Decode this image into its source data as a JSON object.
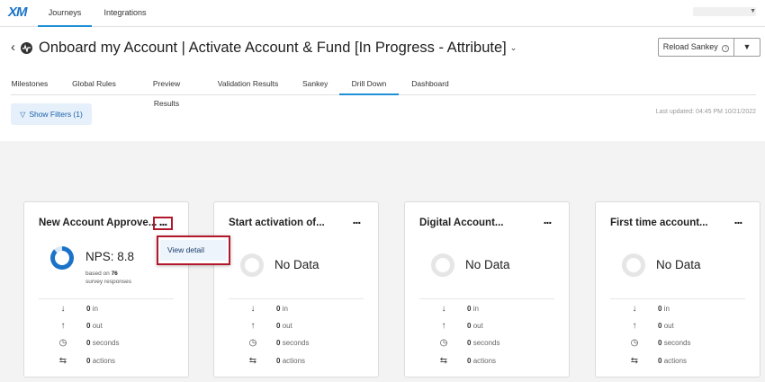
{
  "topnav": {
    "logo": "XM",
    "tabs": [
      {
        "label": "Journeys"
      },
      {
        "label": "Integrations"
      }
    ]
  },
  "header": {
    "title": "Onboard my Account | Activate Account & Fund [In Progress - Attribute]",
    "reload_label": "Reload Sankey",
    "reload_caret": "▼"
  },
  "subtabs": [
    {
      "label": "Milestones"
    },
    {
      "label": "Global Rules"
    },
    {
      "label": "Preview Results"
    },
    {
      "label": "Validation Results"
    },
    {
      "label": "Sankey"
    },
    {
      "label": "Drill Down"
    },
    {
      "label": "Dashboard"
    }
  ],
  "filters": {
    "label": "Show Filters (1)",
    "last_updated": "Last updated: 04:45 PM 10/21/2022"
  },
  "cards": [
    {
      "title": "New Account Approve...",
      "nps_label": "NPS: 8.8",
      "nps_value": 8.8,
      "based_prefix": "based on",
      "based_count": "76",
      "based_suffix": "survey responses",
      "stats": {
        "in": "0",
        "in_label": "in",
        "out": "0",
        "out_label": "out",
        "seconds": "0",
        "seconds_label": "seconds",
        "actions": "0",
        "actions_label": "actions"
      }
    },
    {
      "title": "Start activation of...",
      "nodata": "No Data",
      "stats": {
        "in": "0",
        "in_label": "in",
        "out": "0",
        "out_label": "out",
        "seconds": "0",
        "seconds_label": "seconds",
        "actions": "0",
        "actions_label": "actions"
      }
    },
    {
      "title": "Digital Account...",
      "nodata": "No Data",
      "stats": {
        "in": "0",
        "in_label": "in",
        "out": "0",
        "out_label": "out",
        "seconds": "0",
        "seconds_label": "seconds",
        "actions": "0",
        "actions_label": "actions"
      }
    },
    {
      "title": "First time account...",
      "nodata": "No Data",
      "stats": {
        "in": "0",
        "in_label": "in",
        "out": "0",
        "out_label": "out",
        "seconds": "0",
        "seconds_label": "seconds",
        "actions": "0",
        "actions_label": "actions"
      }
    }
  ],
  "popup": {
    "item": "View detail"
  },
  "colors": {
    "accent": "#1f8fd6",
    "highlight": "#b2182b",
    "filter_bg": "#e6f0fb"
  }
}
